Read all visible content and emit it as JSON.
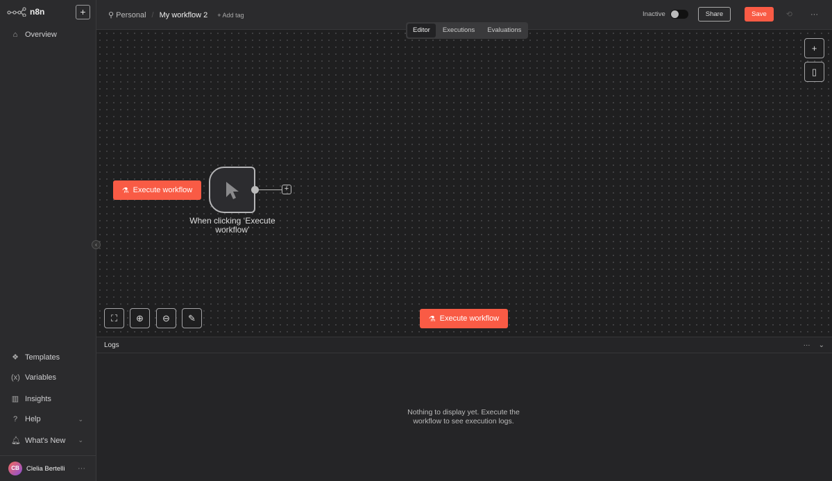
{
  "app": {
    "name": "n8n"
  },
  "colors": {
    "accent": "#f95b45",
    "canvas": "#1f1f20",
    "sidebar": "#2b2b2d"
  },
  "sidebar": {
    "top_items": [
      {
        "label": "Overview",
        "icon": "home-icon"
      }
    ],
    "bottom_items": [
      {
        "label": "Templates",
        "icon": "templates-icon"
      },
      {
        "label": "Variables",
        "icon": "variables-icon"
      },
      {
        "label": "Insights",
        "icon": "insights-icon"
      },
      {
        "label": "Help",
        "icon": "help-icon"
      },
      {
        "label": "What's New",
        "icon": "bell-icon"
      }
    ],
    "user": {
      "initials": "CB",
      "name": "Clelia Bertelli"
    }
  },
  "header": {
    "project": "Personal",
    "workflow_name": "My workflow 2",
    "add_tag": "+ Add tag",
    "status": "Inactive",
    "active": false,
    "share": "Share",
    "save": "Save"
  },
  "tabs": [
    {
      "label": "Editor",
      "active": true
    },
    {
      "label": "Executions",
      "active": false
    },
    {
      "label": "Evaluations",
      "active": false
    }
  ],
  "canvas": {
    "execute_label": "Execute workflow",
    "node_label": "When clicking ‘Execute workflow’"
  },
  "logs": {
    "title": "Logs",
    "empty": "Nothing to display yet. Execute the workflow to see execution logs."
  }
}
